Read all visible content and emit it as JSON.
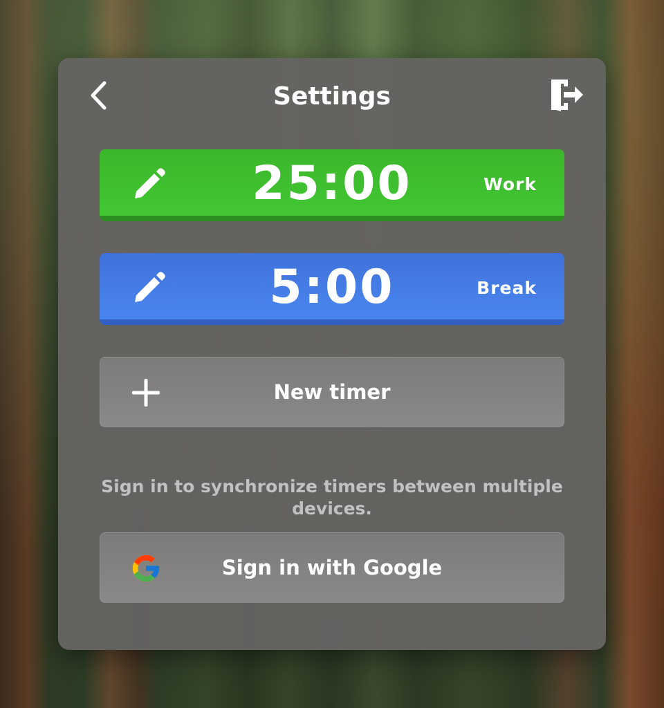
{
  "header": {
    "title": "Settings",
    "back_icon": "chevron-left-icon",
    "exit_icon": "sign-out-icon"
  },
  "timers": [
    {
      "time": "25:00",
      "label": "Work",
      "color": "#3cbc2c",
      "icon": "pencil-icon"
    },
    {
      "time": "5:00",
      "label": "Break",
      "color": "#4479e4",
      "icon": "pencil-icon"
    }
  ],
  "new_timer": {
    "label": "New timer",
    "icon": "plus-icon"
  },
  "sync": {
    "hint": "Sign in to synchronize timers between multiple devices.",
    "google_label": "Sign in with Google",
    "google_icon": "google-logo-icon"
  }
}
